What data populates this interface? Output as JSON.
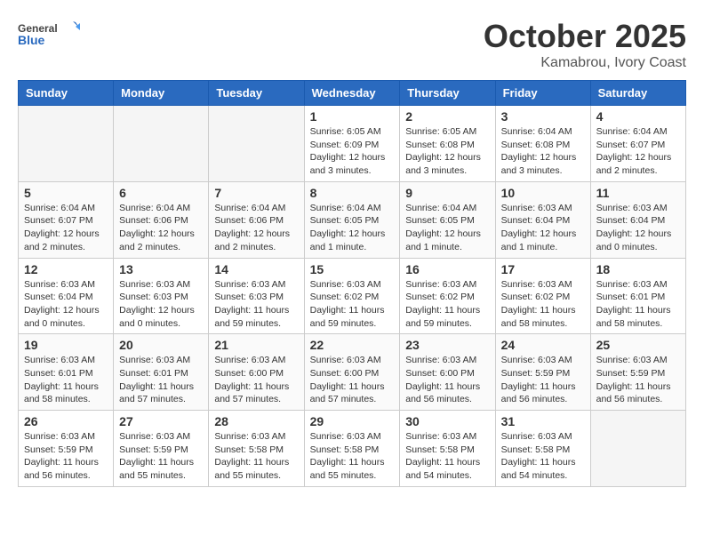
{
  "header": {
    "logo_general": "General",
    "logo_blue": "Blue",
    "month": "October 2025",
    "location": "Kamabrou, Ivory Coast"
  },
  "weekdays": [
    "Sunday",
    "Monday",
    "Tuesday",
    "Wednesday",
    "Thursday",
    "Friday",
    "Saturday"
  ],
  "weeks": [
    [
      {
        "day": "",
        "info": ""
      },
      {
        "day": "",
        "info": ""
      },
      {
        "day": "",
        "info": ""
      },
      {
        "day": "1",
        "info": "Sunrise: 6:05 AM\nSunset: 6:09 PM\nDaylight: 12 hours\nand 3 minutes."
      },
      {
        "day": "2",
        "info": "Sunrise: 6:05 AM\nSunset: 6:08 PM\nDaylight: 12 hours\nand 3 minutes."
      },
      {
        "day": "3",
        "info": "Sunrise: 6:04 AM\nSunset: 6:08 PM\nDaylight: 12 hours\nand 3 minutes."
      },
      {
        "day": "4",
        "info": "Sunrise: 6:04 AM\nSunset: 6:07 PM\nDaylight: 12 hours\nand 2 minutes."
      }
    ],
    [
      {
        "day": "5",
        "info": "Sunrise: 6:04 AM\nSunset: 6:07 PM\nDaylight: 12 hours\nand 2 minutes."
      },
      {
        "day": "6",
        "info": "Sunrise: 6:04 AM\nSunset: 6:06 PM\nDaylight: 12 hours\nand 2 minutes."
      },
      {
        "day": "7",
        "info": "Sunrise: 6:04 AM\nSunset: 6:06 PM\nDaylight: 12 hours\nand 2 minutes."
      },
      {
        "day": "8",
        "info": "Sunrise: 6:04 AM\nSunset: 6:05 PM\nDaylight: 12 hours\nand 1 minute."
      },
      {
        "day": "9",
        "info": "Sunrise: 6:04 AM\nSunset: 6:05 PM\nDaylight: 12 hours\nand 1 minute."
      },
      {
        "day": "10",
        "info": "Sunrise: 6:03 AM\nSunset: 6:04 PM\nDaylight: 12 hours\nand 1 minute."
      },
      {
        "day": "11",
        "info": "Sunrise: 6:03 AM\nSunset: 6:04 PM\nDaylight: 12 hours\nand 0 minutes."
      }
    ],
    [
      {
        "day": "12",
        "info": "Sunrise: 6:03 AM\nSunset: 6:04 PM\nDaylight: 12 hours\nand 0 minutes."
      },
      {
        "day": "13",
        "info": "Sunrise: 6:03 AM\nSunset: 6:03 PM\nDaylight: 12 hours\nand 0 minutes."
      },
      {
        "day": "14",
        "info": "Sunrise: 6:03 AM\nSunset: 6:03 PM\nDaylight: 11 hours\nand 59 minutes."
      },
      {
        "day": "15",
        "info": "Sunrise: 6:03 AM\nSunset: 6:02 PM\nDaylight: 11 hours\nand 59 minutes."
      },
      {
        "day": "16",
        "info": "Sunrise: 6:03 AM\nSunset: 6:02 PM\nDaylight: 11 hours\nand 59 minutes."
      },
      {
        "day": "17",
        "info": "Sunrise: 6:03 AM\nSunset: 6:02 PM\nDaylight: 11 hours\nand 58 minutes."
      },
      {
        "day": "18",
        "info": "Sunrise: 6:03 AM\nSunset: 6:01 PM\nDaylight: 11 hours\nand 58 minutes."
      }
    ],
    [
      {
        "day": "19",
        "info": "Sunrise: 6:03 AM\nSunset: 6:01 PM\nDaylight: 11 hours\nand 58 minutes."
      },
      {
        "day": "20",
        "info": "Sunrise: 6:03 AM\nSunset: 6:01 PM\nDaylight: 11 hours\nand 57 minutes."
      },
      {
        "day": "21",
        "info": "Sunrise: 6:03 AM\nSunset: 6:00 PM\nDaylight: 11 hours\nand 57 minutes."
      },
      {
        "day": "22",
        "info": "Sunrise: 6:03 AM\nSunset: 6:00 PM\nDaylight: 11 hours\nand 57 minutes."
      },
      {
        "day": "23",
        "info": "Sunrise: 6:03 AM\nSunset: 6:00 PM\nDaylight: 11 hours\nand 56 minutes."
      },
      {
        "day": "24",
        "info": "Sunrise: 6:03 AM\nSunset: 5:59 PM\nDaylight: 11 hours\nand 56 minutes."
      },
      {
        "day": "25",
        "info": "Sunrise: 6:03 AM\nSunset: 5:59 PM\nDaylight: 11 hours\nand 56 minutes."
      }
    ],
    [
      {
        "day": "26",
        "info": "Sunrise: 6:03 AM\nSunset: 5:59 PM\nDaylight: 11 hours\nand 56 minutes."
      },
      {
        "day": "27",
        "info": "Sunrise: 6:03 AM\nSunset: 5:59 PM\nDaylight: 11 hours\nand 55 minutes."
      },
      {
        "day": "28",
        "info": "Sunrise: 6:03 AM\nSunset: 5:58 PM\nDaylight: 11 hours\nand 55 minutes."
      },
      {
        "day": "29",
        "info": "Sunrise: 6:03 AM\nSunset: 5:58 PM\nDaylight: 11 hours\nand 55 minutes."
      },
      {
        "day": "30",
        "info": "Sunrise: 6:03 AM\nSunset: 5:58 PM\nDaylight: 11 hours\nand 54 minutes."
      },
      {
        "day": "31",
        "info": "Sunrise: 6:03 AM\nSunset: 5:58 PM\nDaylight: 11 hours\nand 54 minutes."
      },
      {
        "day": "",
        "info": ""
      }
    ]
  ]
}
